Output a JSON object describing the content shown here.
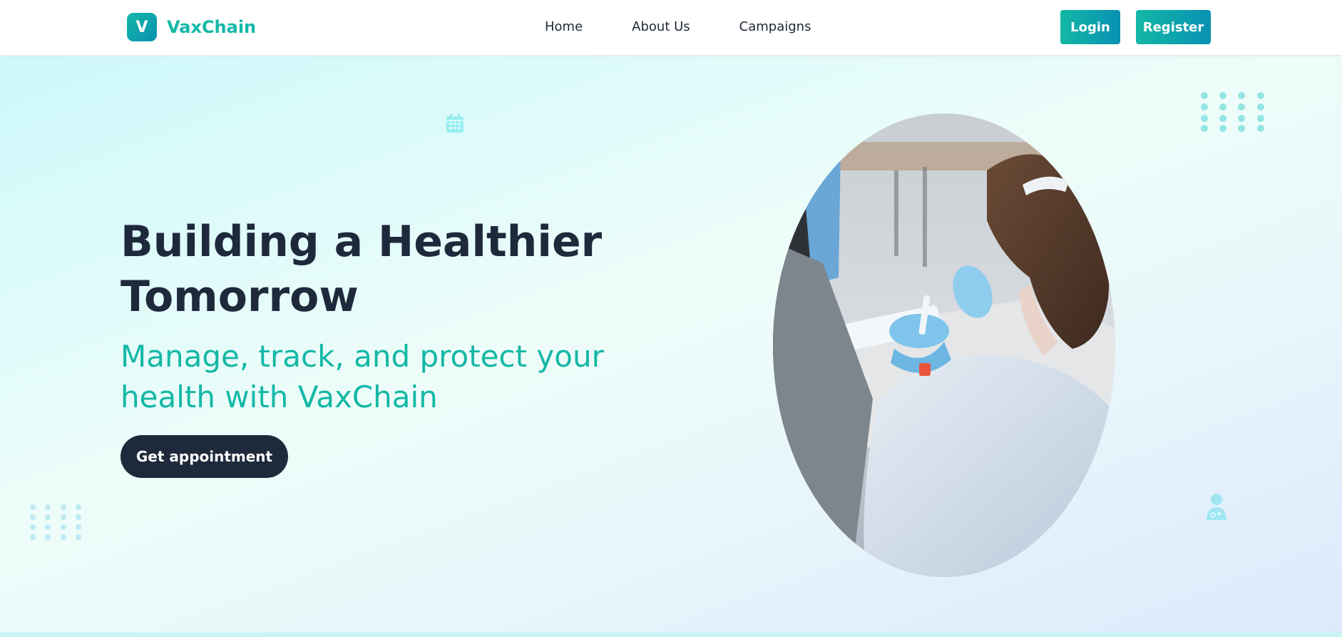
{
  "brand": {
    "logo_letter": "V",
    "name": "VaxChain",
    "accent": "#14b8a6"
  },
  "nav": {
    "links": [
      {
        "label": "Home"
      },
      {
        "label": "About Us"
      },
      {
        "label": "Campaigns"
      }
    ],
    "login_label": "Login",
    "register_label": "Register"
  },
  "hero": {
    "title_line1": "Building a Healthier",
    "title_line2": "Tomorrow",
    "subtitle_line1": "Manage, track, and protect your",
    "subtitle_line2": "health with VaxChain",
    "cta_label": "Get appointment",
    "image": {
      "description_icon": "photo-lab-worker"
    },
    "decor_icons": [
      "calendar-icon",
      "doctor-icon",
      "dot-grid-pattern"
    ]
  },
  "colors": {
    "primary": "#14b8a6",
    "secondary": "#0891b2",
    "dark": "#1e293b"
  }
}
